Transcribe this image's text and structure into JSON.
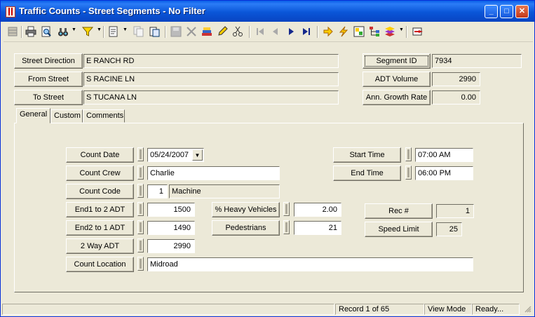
{
  "window": {
    "title": "Traffic Counts - Street Segments - No Filter",
    "minimize_glyph": "_",
    "maximize_glyph": "□",
    "close_glyph": "✕"
  },
  "toolbar": {
    "icons": [
      "grid-icon",
      "print-icon",
      "print-preview-icon",
      "binoculars-icon",
      "filter-icon",
      "new-record-icon",
      "copy-record-icon",
      "paste-icon",
      "save-icon",
      "delete-icon",
      "books-icon",
      "pencil-icon",
      "scissors-icon",
      "first-record-icon",
      "previous-record-icon",
      "next-record-icon",
      "last-record-icon",
      "arrow-right-icon",
      "lightning-icon",
      "map-grid-icon",
      "tree-icon",
      "books-stack-icon",
      "exit-icon"
    ]
  },
  "header": {
    "street_direction_label": "Street Direction",
    "street_direction_value": "E RANCH RD",
    "from_street_label": "From Street",
    "from_street_value": "S RACINE LN",
    "to_street_label": "To Street",
    "to_street_value": "S TUCANA LN",
    "segment_id_label": "Segment ID",
    "segment_id_value": "7934",
    "adt_volume_label": "ADT Volume",
    "adt_volume_value": "2990",
    "growth_rate_label": "Ann. Growth Rate",
    "growth_rate_value": "0.00"
  },
  "tabs": [
    {
      "label": "General"
    },
    {
      "label": "Custom"
    },
    {
      "label": "Comments"
    }
  ],
  "general": {
    "count_date_label": "Count Date",
    "count_date_value": "05/24/2007",
    "count_crew_label": "Count Crew",
    "count_crew_value": "Charlie",
    "count_code_label": "Count Code",
    "count_code_value": "1",
    "count_code_desc": "Machine",
    "end1_label": "End1 to 2 ADT",
    "end1_value": "1500",
    "end2_label": "End2 to 1 ADT",
    "end2_value": "1490",
    "two_way_label": "2 Way ADT",
    "two_way_value": "2990",
    "location_label": "Count Location",
    "location_value": "Midroad",
    "heavy_label": "% Heavy Vehicles",
    "heavy_value": "2.00",
    "ped_label": "Pedestrians",
    "ped_value": "21",
    "start_time_label": "Start Time",
    "start_time_value": "07:00 AM",
    "end_time_label": "End Time",
    "end_time_value": "06:00 PM",
    "rec_label": "Rec #",
    "rec_value": "1",
    "speed_label": "Speed Limit",
    "speed_value": "25"
  },
  "status": {
    "record": "Record 1 of 65",
    "mode": "View Mode",
    "state": "Ready..."
  }
}
